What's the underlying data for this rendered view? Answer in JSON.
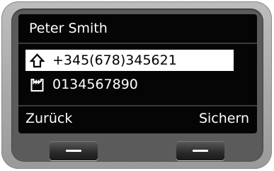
{
  "header": {
    "title": "Peter Smith"
  },
  "entries": [
    {
      "icon": "home-phone-icon",
      "number": "+345(678)345621",
      "selected": true
    },
    {
      "icon": "office-phone-icon",
      "number": "0134567890",
      "selected": false
    }
  ],
  "softkeys": {
    "left_label": "Zurück",
    "right_label": "Sichern"
  },
  "colors": {
    "screen": "#050505",
    "highlight": "#ffffff",
    "text": "#ffffff",
    "housing": "#a9a9a9"
  }
}
